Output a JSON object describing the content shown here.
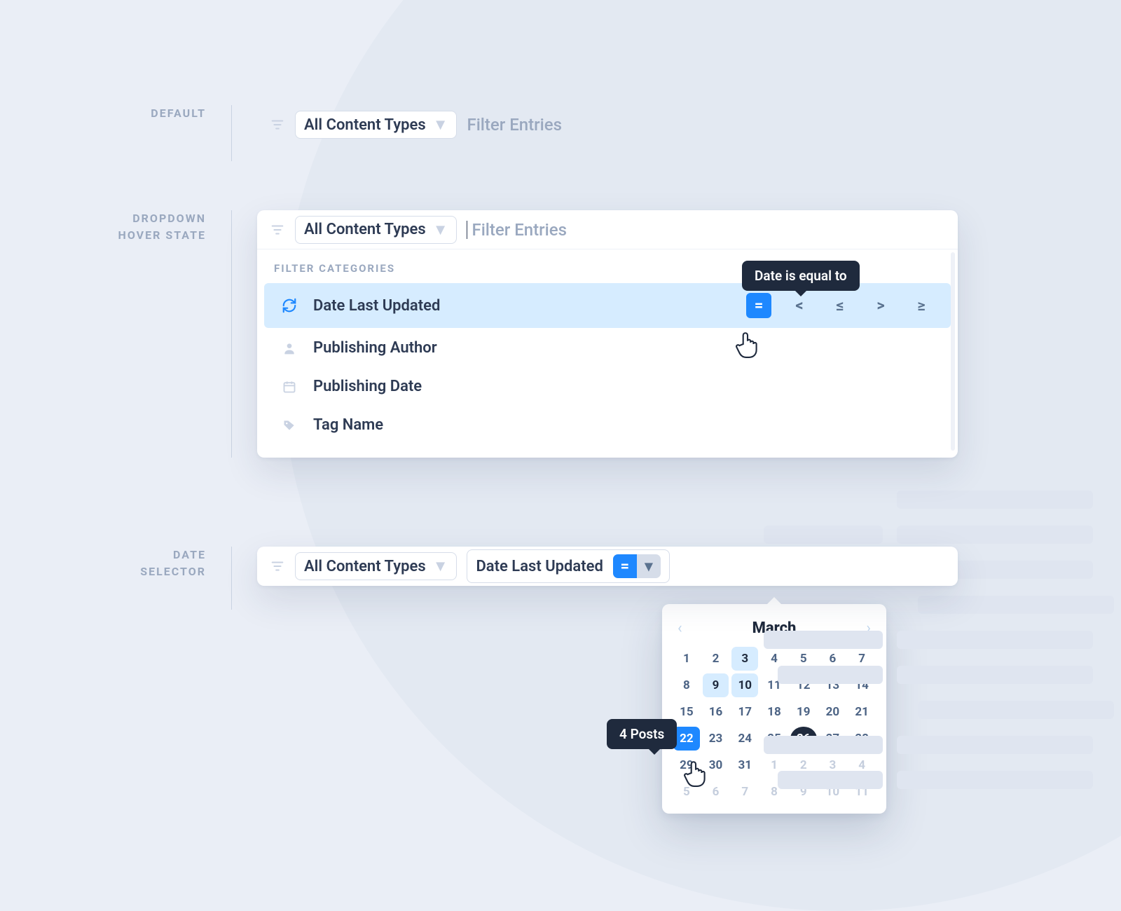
{
  "labels": {
    "default": "DEFAULT",
    "hover1": "DROPDOWN",
    "hover2": "HOVER STATE",
    "date1": "DATE",
    "date2": "SELECTOR"
  },
  "chip": {
    "allTypes": "All Content Types",
    "placeholder": "Filter Entries"
  },
  "dropdown": {
    "section": "FILTER CATEGORIES",
    "items": [
      {
        "label": "Date Last Updated",
        "icon": "refresh"
      },
      {
        "label": "Publishing Author",
        "icon": "user"
      },
      {
        "label": "Publishing Date",
        "icon": "calendar"
      },
      {
        "label": "Tag Name",
        "icon": "tag"
      }
    ],
    "tooltip": "Date is equal to",
    "ops": [
      "=",
      "<",
      "≤",
      ">",
      "≥"
    ]
  },
  "dateRow": {
    "filterLabel": "Date Last Updated"
  },
  "calendar": {
    "month": "March",
    "tooltip": "4 Posts",
    "days": [
      {
        "n": "1"
      },
      {
        "n": "2"
      },
      {
        "n": "3",
        "hl": true
      },
      {
        "n": "4"
      },
      {
        "n": "5"
      },
      {
        "n": "6"
      },
      {
        "n": "7"
      },
      {
        "n": "8"
      },
      {
        "n": "9",
        "hl": true
      },
      {
        "n": "10",
        "hl": true
      },
      {
        "n": "11"
      },
      {
        "n": "12"
      },
      {
        "n": "13"
      },
      {
        "n": "14"
      },
      {
        "n": "15"
      },
      {
        "n": "16"
      },
      {
        "n": "17"
      },
      {
        "n": "18"
      },
      {
        "n": "19"
      },
      {
        "n": "20"
      },
      {
        "n": "21"
      },
      {
        "n": "22",
        "sel": true
      },
      {
        "n": "23"
      },
      {
        "n": "24"
      },
      {
        "n": "25"
      },
      {
        "n": "26",
        "dark": true
      },
      {
        "n": "27"
      },
      {
        "n": "28"
      },
      {
        "n": "29"
      },
      {
        "n": "30"
      },
      {
        "n": "31"
      },
      {
        "n": "1",
        "mut": true
      },
      {
        "n": "2",
        "mut": true
      },
      {
        "n": "3",
        "mut": true
      },
      {
        "n": "4",
        "mut": true
      },
      {
        "n": "5",
        "mut": true
      },
      {
        "n": "6",
        "mut": true
      },
      {
        "n": "7",
        "mut": true
      },
      {
        "n": "8",
        "mut": true
      },
      {
        "n": "9",
        "mut": true
      },
      {
        "n": "10",
        "mut": true
      },
      {
        "n": "11",
        "mut": true
      }
    ]
  }
}
